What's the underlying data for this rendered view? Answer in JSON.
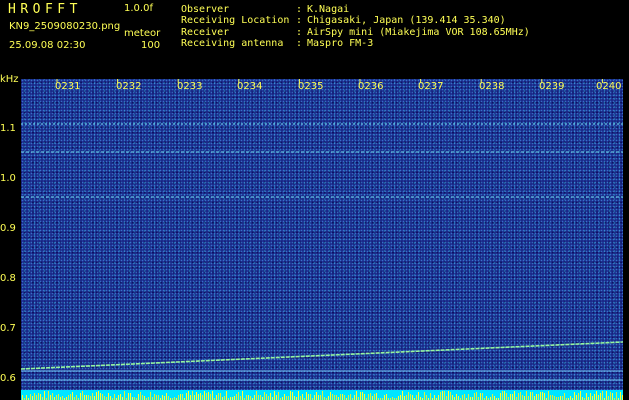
{
  "header": {
    "app_title": "HROFFT",
    "version": "1.0.0f",
    "filename": "KN9_2509080230.png",
    "mode_label": "meteor",
    "datetime": "25.09.08 02:30",
    "count": "100"
  },
  "station": [
    {
      "label": "Observer",
      "value": "K.Nagai"
    },
    {
      "label": "Receiving Location",
      "value": "Chigasaki, Japan (139.414 35.340)"
    },
    {
      "label": "Receiver",
      "value": "AirSpy mini (Miakejima VOR 108.65MHz)"
    },
    {
      "label": "Receiving antenna",
      "value": "Maspro FM-3"
    }
  ],
  "spectrogram": {
    "y_unit": "kHz",
    "y_ticks": [
      "1.1",
      "1.0",
      "0.9",
      "0.8",
      "0.7",
      "0.6"
    ],
    "x_ticks": [
      "0231",
      "0232",
      "0233",
      "0234",
      "0235",
      "0236",
      "0237",
      "0238",
      "0239",
      "0240"
    ],
    "colors": {
      "background": "#1b2a8a",
      "text": "#ffff55",
      "trace": "#7fffd4",
      "signal": "#00ffff"
    }
  }
}
